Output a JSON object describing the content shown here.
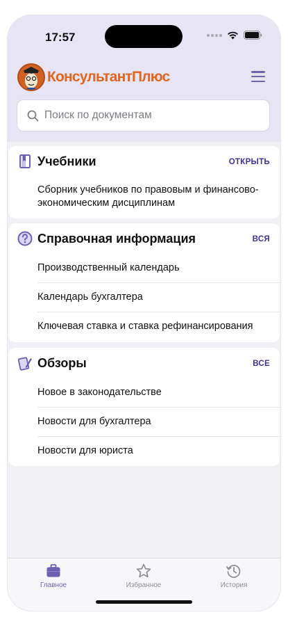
{
  "status_bar": {
    "time": "17:57"
  },
  "app": {
    "logo_text": "КонсультантПлюс"
  },
  "search": {
    "placeholder": "Поиск по документам"
  },
  "sections": [
    {
      "title": "Учебники",
      "action": "ОТКРЫТЬ",
      "icon": "book-icon",
      "items": [
        "Сборник учебников по правовым и финансово-экономическим дисциплинам"
      ]
    },
    {
      "title": "Справочная информация",
      "action": "ВСЯ",
      "icon": "question-circle-icon",
      "items": [
        "Производственный календарь",
        "Календарь бухгалтера",
        "Ключевая ставка и ставка рефинансирования"
      ]
    },
    {
      "title": "Обзоры",
      "action": "ВСЕ",
      "icon": "reviews-icon",
      "items": [
        "Новое в законодательстве",
        "Новости для бухгалтера",
        "Новости для юриста"
      ]
    }
  ],
  "tabbar": {
    "items": [
      {
        "label": "Главное",
        "icon": "briefcase-icon",
        "active": true
      },
      {
        "label": "Избранное",
        "icon": "star-icon",
        "active": false
      },
      {
        "label": "История",
        "icon": "history-icon",
        "active": false
      }
    ]
  },
  "colors": {
    "accent": "#3b339a",
    "header_bg": "#e7e4f4",
    "logo": "#e0671f",
    "active_tab": "#6a5fb0"
  }
}
